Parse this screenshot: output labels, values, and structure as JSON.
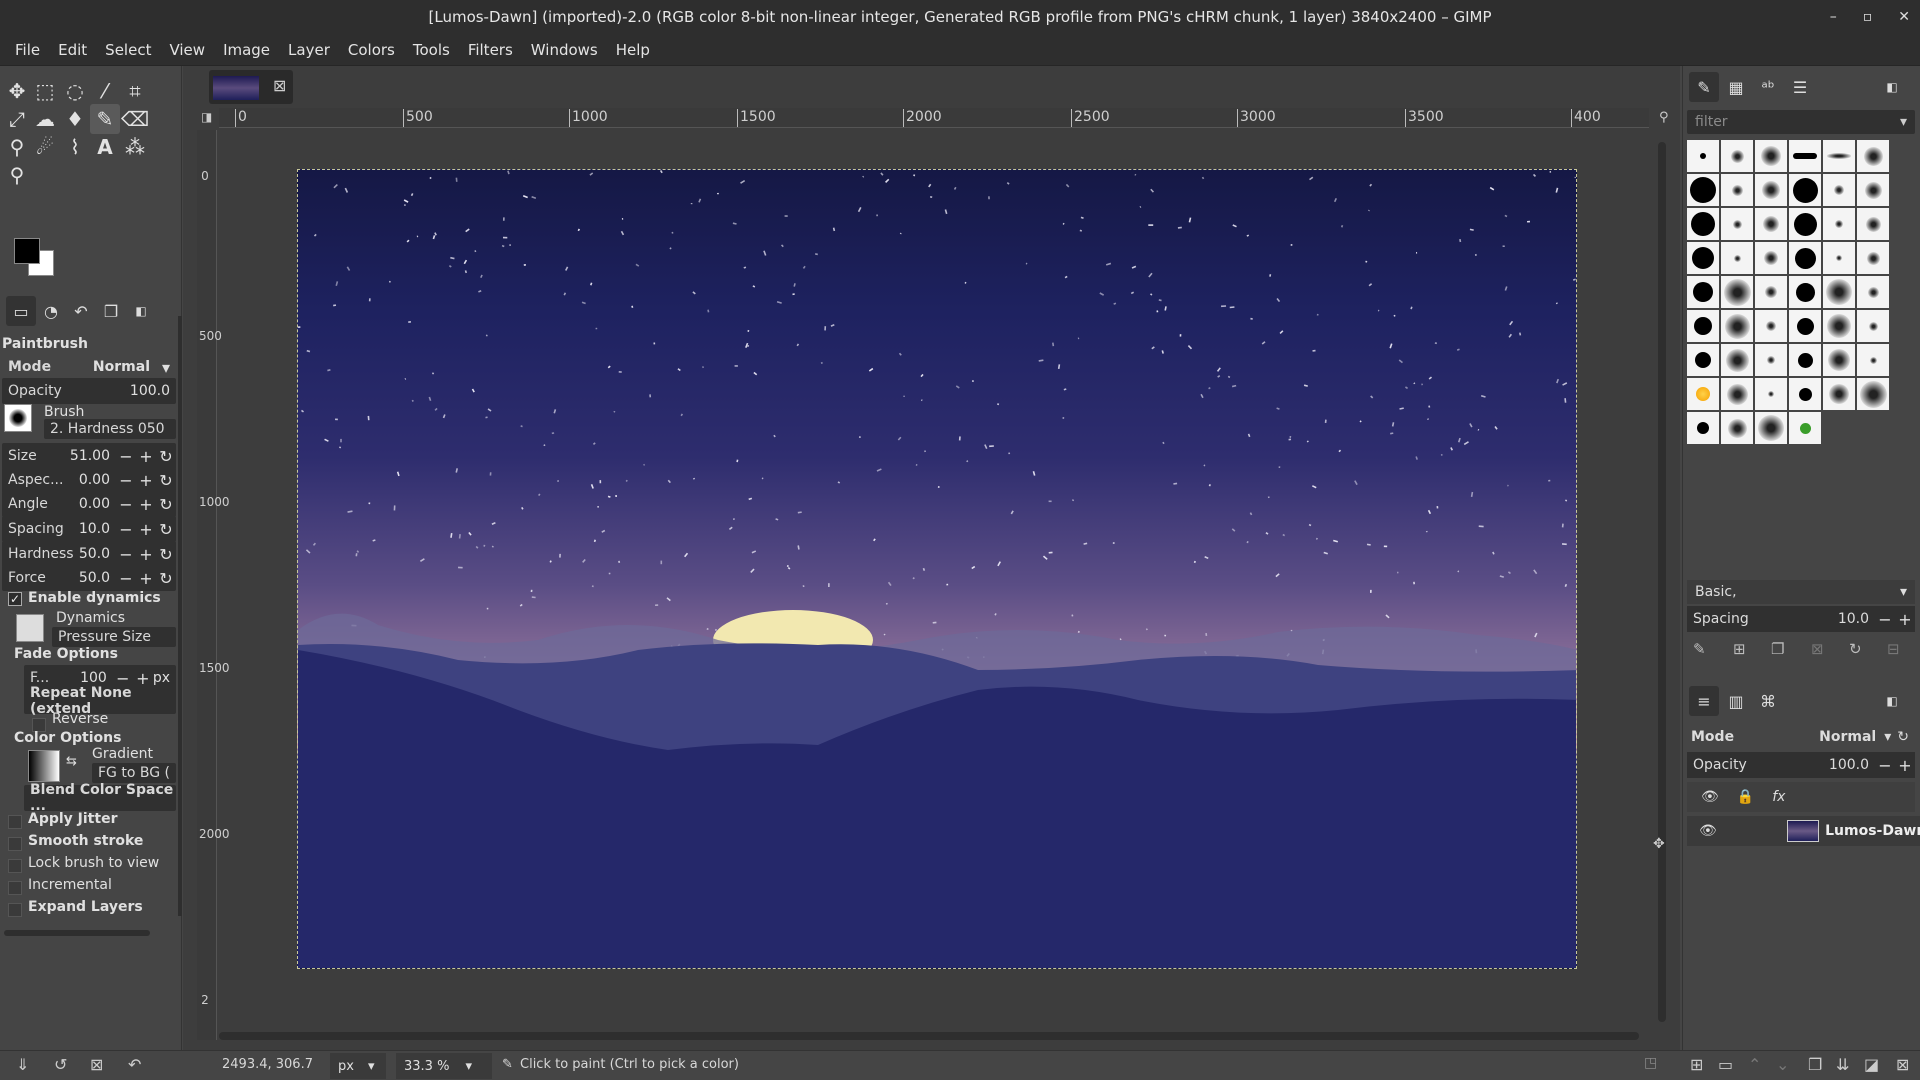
{
  "window": {
    "title": "[Lumos-Dawn] (imported)-2.0 (RGB color 8-bit non-linear integer, Generated RGB profile from PNG's cHRM chunk, 1 layer) 3840x2400 – GIMP",
    "controls": [
      "–",
      "▫",
      "✕"
    ]
  },
  "menu": [
    "File",
    "Edit",
    "Select",
    "View",
    "Image",
    "Layer",
    "Colors",
    "Tools",
    "Filters",
    "Windows",
    "Help"
  ],
  "tool_options": {
    "title": "Paintbrush",
    "mode_label": "Mode",
    "mode_value": "Normal",
    "opacity_label": "Opacity",
    "opacity_value": "100.0",
    "brush_label": "Brush",
    "brush_name": "2. Hardness 050",
    "size_label": "Size",
    "size_value": "51.00",
    "aspect_label": "Aspec...",
    "aspect_value": "0.00",
    "angle_label": "Angle",
    "angle_value": "0.00",
    "spacing_label": "Spacing",
    "spacing_value": "10.0",
    "hardness_label": "Hardness",
    "hardness_value": "50.0",
    "force_label": "Force",
    "force_value": "50.0",
    "enable_dynamics": "Enable dynamics",
    "dynamics_label": "Dynamics",
    "dynamics_value": "Pressure Size",
    "fade_options": "Fade Options",
    "fade_label": "F...",
    "fade_value": "100",
    "fade_unit": "px",
    "repeat": "Repeat None (extend",
    "reverse": "Reverse",
    "color_options": "Color Options",
    "gradient_label": "Gradient",
    "gradient_value": "FG to BG (",
    "blend_space": "Blend Color Space ...",
    "apply_jitter": "Apply Jitter",
    "smooth_stroke": "Smooth stroke",
    "lock_brush": "Lock brush to view",
    "incremental": "Incremental",
    "expand_layers": "Expand Layers"
  },
  "rulers": {
    "h": [
      "0",
      "500",
      "1000",
      "1500",
      "2000",
      "2500",
      "3000",
      "3500",
      "400"
    ],
    "v": [
      "0",
      "500",
      "1000",
      "1500",
      "2000",
      "2"
    ]
  },
  "brushes_panel": {
    "filter_placeholder": "filter",
    "tag": "Basic,",
    "spacing_label": "Spacing",
    "spacing_value": "10.0"
  },
  "layers_panel": {
    "mode_label": "Mode",
    "mode_value": "Normal",
    "opacity_label": "Opacity",
    "opacity_value": "100.0",
    "fx_label": "fx",
    "layer_name": "Lumos-Dawn"
  },
  "status": {
    "coords": "2493.4, 306.7",
    "unit": "px",
    "zoom": "33.3 %",
    "message": "Click to paint (Ctrl to pick a color)"
  },
  "colors": {
    "fg": "#000000",
    "bg": "#ffffff",
    "sky_top": "#151845",
    "horizon": "#c48fa7",
    "sun": "#f2e8b0",
    "mountains": "#2d3070"
  }
}
